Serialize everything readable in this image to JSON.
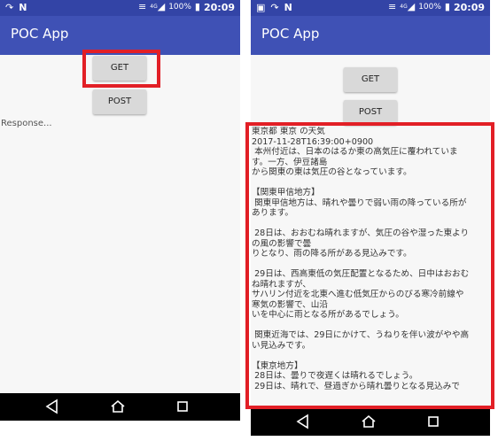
{
  "status": {
    "time": "20:09",
    "battery": "100%",
    "network": "4G"
  },
  "app": {
    "title": "POC App"
  },
  "buttons": {
    "get": "GET",
    "post": "POST"
  },
  "response": {
    "placeholder": "Response...",
    "lines": [
      "東京都 東京 の天気",
      "2017-11-28T16:39:00+0900",
      " 本州付近は、日本のはるか東の高気圧に覆われていま",
      "す。一方、伊豆諸島",
      "から関東の東は気圧の谷となっています。",
      "",
      "【関東甲信地方】",
      " 関東甲信地方は、晴れや曇りで弱い雨の降っている所が",
      "あります。",
      "",
      " 28日は、おおむね晴れますが、気圧の谷や湿った東より",
      "の風の影響で曇",
      "りとなり、雨の降る所がある見込みです。",
      "",
      " 29日は、西高東低の気圧配置となるため、日中はおおむ",
      "ね晴れますが、",
      "サハリン付近を北東へ進む低気圧からのびる寒冷前線や",
      "寒気の影響で、山沿",
      "いを中心に雨となる所があるでしょう。",
      "",
      " 関東近海では、29日にかけて、うねりを伴い波がやや高",
      "い見込みです。",
      "",
      "【東京地方】",
      " 28日は、曇りで夜遅くは晴れるでしょう。",
      " 29日は、晴れで、昼過ぎから晴れ曇りとなる見込みで"
    ]
  },
  "icons": {
    "status": [
      "notification-icon",
      "photo-icon",
      "n-icon"
    ],
    "right": [
      "vibrate-icon",
      "signal-icon",
      "battery-icon"
    ],
    "nav": [
      "back-icon",
      "home-icon",
      "recents-icon"
    ]
  },
  "colors": {
    "statusbar": "#3344a6",
    "appbar": "#3f51b5",
    "highlight": "#e21f26"
  }
}
